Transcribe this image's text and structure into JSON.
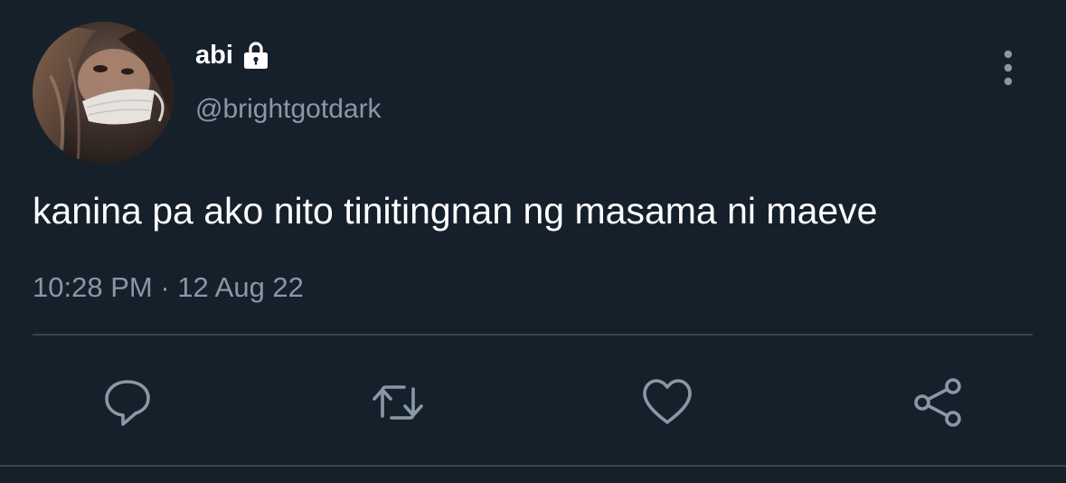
{
  "user": {
    "display_name": "abi",
    "handle": "@brightgotdark",
    "avatar_icon": "profile-photo",
    "protected_icon": "lock-icon"
  },
  "tweet": {
    "text": "kanina pa ako nito tinitingnan ng masama ni maeve",
    "time": "10:28 PM",
    "separator": "·",
    "date": "12 Aug 22"
  },
  "actions": [
    {
      "name": "reply",
      "icon": "reply-icon"
    },
    {
      "name": "retweet",
      "icon": "retweet-icon"
    },
    {
      "name": "like",
      "icon": "heart-icon"
    },
    {
      "name": "share",
      "icon": "share-icon"
    }
  ],
  "colors": {
    "background": "#15202b",
    "primary_text": "#ffffff",
    "secondary_text": "#8899a6",
    "divider": "#38444d"
  }
}
